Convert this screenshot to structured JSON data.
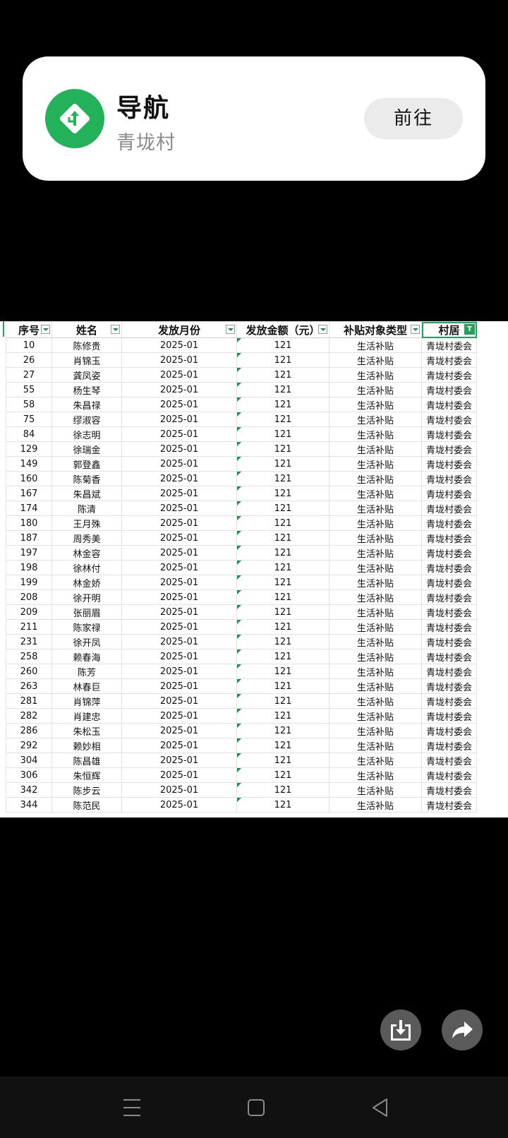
{
  "nav_card": {
    "title": "导航",
    "subtitle": "青垅村",
    "go_label": "前往",
    "accent": "#23b25a"
  },
  "sheet": {
    "headers": [
      "序号",
      "姓名",
      "发放月份",
      "发放金额（元）",
      "补贴对象类型",
      "村居"
    ],
    "active_filter_icon": "T",
    "rows": [
      [
        "10",
        "陈修贵",
        "2025-01",
        "121",
        "生活补贴",
        "青垅村委会"
      ],
      [
        "26",
        "肖锦玉",
        "2025-01",
        "121",
        "生活补贴",
        "青垅村委会"
      ],
      [
        "27",
        "龚凤姿",
        "2025-01",
        "121",
        "生活补贴",
        "青垅村委会"
      ],
      [
        "55",
        "杨生琴",
        "2025-01",
        "121",
        "生活补贴",
        "青垅村委会"
      ],
      [
        "58",
        "朱昌禄",
        "2025-01",
        "121",
        "生活补贴",
        "青垅村委会"
      ],
      [
        "75",
        "缪淑容",
        "2025-01",
        "121",
        "生活补贴",
        "青垅村委会"
      ],
      [
        "84",
        "徐志明",
        "2025-01",
        "121",
        "生活补贴",
        "青垅村委会"
      ],
      [
        "129",
        "徐瑞金",
        "2025-01",
        "121",
        "生活补贴",
        "青垅村委会"
      ],
      [
        "149",
        "郭登鑫",
        "2025-01",
        "121",
        "生活补贴",
        "青垅村委会"
      ],
      [
        "160",
        "陈菊香",
        "2025-01",
        "121",
        "生活补贴",
        "青垅村委会"
      ],
      [
        "167",
        "朱昌斌",
        "2025-01",
        "121",
        "生活补贴",
        "青垅村委会"
      ],
      [
        "174",
        "陈清",
        "2025-01",
        "121",
        "生活补贴",
        "青垅村委会"
      ],
      [
        "180",
        "王月殊",
        "2025-01",
        "121",
        "生活补贴",
        "青垅村委会"
      ],
      [
        "187",
        "周秀美",
        "2025-01",
        "121",
        "生活补贴",
        "青垅村委会"
      ],
      [
        "197",
        "林金容",
        "2025-01",
        "121",
        "生活补贴",
        "青垅村委会"
      ],
      [
        "198",
        "徐林付",
        "2025-01",
        "121",
        "生活补贴",
        "青垅村委会"
      ],
      [
        "199",
        "林金娇",
        "2025-01",
        "121",
        "生活补贴",
        "青垅村委会"
      ],
      [
        "208",
        "徐开明",
        "2025-01",
        "121",
        "生活补贴",
        "青垅村委会"
      ],
      [
        "209",
        "张丽眉",
        "2025-01",
        "121",
        "生活补贴",
        "青垅村委会"
      ],
      [
        "211",
        "陈家禄",
        "2025-01",
        "121",
        "生活补贴",
        "青垅村委会"
      ],
      [
        "231",
        "徐开凤",
        "2025-01",
        "121",
        "生活补贴",
        "青垅村委会"
      ],
      [
        "258",
        "赖春海",
        "2025-01",
        "121",
        "生活补贴",
        "青垅村委会"
      ],
      [
        "260",
        "陈芳",
        "2025-01",
        "121",
        "生活补贴",
        "青垅村委会"
      ],
      [
        "263",
        "林春巨",
        "2025-01",
        "121",
        "生活补贴",
        "青垅村委会"
      ],
      [
        "281",
        "肖锦萍",
        "2025-01",
        "121",
        "生活补贴",
        "青垅村委会"
      ],
      [
        "282",
        "肖建忠",
        "2025-01",
        "121",
        "生活补贴",
        "青垅村委会"
      ],
      [
        "286",
        "朱松玉",
        "2025-01",
        "121",
        "生活补贴",
        "青垅村委会"
      ],
      [
        "292",
        "赖妙相",
        "2025-01",
        "121",
        "生活补贴",
        "青垅村委会"
      ],
      [
        "304",
        "陈昌雄",
        "2025-01",
        "121",
        "生活补贴",
        "青垅村委会"
      ],
      [
        "306",
        "朱恒辉",
        "2025-01",
        "121",
        "生活补贴",
        "青垅村委会"
      ],
      [
        "342",
        "陈步云",
        "2025-01",
        "121",
        "生活补贴",
        "青垅村委会"
      ],
      [
        "344",
        "陈范民",
        "2025-01",
        "121",
        "生活补贴",
        "青垅村委会"
      ]
    ]
  },
  "actions": {
    "download_icon": "download-icon",
    "share_icon": "share-icon"
  },
  "system_nav": {
    "menu_icon": "menu-icon",
    "home_icon": "home-icon",
    "back_icon": "back-icon"
  }
}
